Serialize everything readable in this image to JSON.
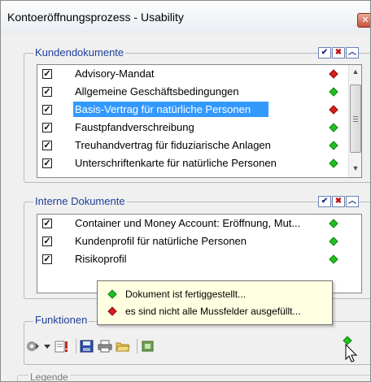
{
  "window": {
    "title": "Kontoeröffnungsprozess - Usability",
    "close_label": "✕"
  },
  "kunden": {
    "legend": "Kundendokumente",
    "items": [
      {
        "label": "Advisory-Mandat",
        "checked": true,
        "status": "red"
      },
      {
        "label": "Allgemeine Geschäftsbedingungen",
        "checked": true,
        "status": "green"
      },
      {
        "label": "Basis-Vertrag für natürliche Personen",
        "checked": true,
        "status": "red",
        "selected": true
      },
      {
        "label": "Faustpfandverschreibung",
        "checked": true,
        "status": "green"
      },
      {
        "label": "Treuhandvertrag für fiduziarische Anlagen",
        "checked": true,
        "status": "green"
      },
      {
        "label": "Unterschriftenkarte für natürliche Personen",
        "checked": true,
        "status": "green"
      }
    ]
  },
  "intern": {
    "legend": "Interne Dokumente",
    "items": [
      {
        "label": "Container und Money Account: Eröffnung, Mut...",
        "checked": true,
        "status": "green"
      },
      {
        "label": "Kundenprofil für natürliche Personen",
        "checked": true,
        "status": "green"
      },
      {
        "label": "Risikoprofil",
        "checked": true,
        "status": "green"
      }
    ]
  },
  "tooltip": {
    "line1": "Dokument ist fertiggestellt...",
    "line2": "es sind nicht alle Mussfelder ausgefüllt..."
  },
  "funktionen": {
    "legend": "Funktionen"
  },
  "legende": {
    "legend": "Legende"
  },
  "colors": {
    "green": "#22c022",
    "red": "#d81e1e",
    "selection": "#3399ff",
    "accent": "#1e3e9a"
  }
}
